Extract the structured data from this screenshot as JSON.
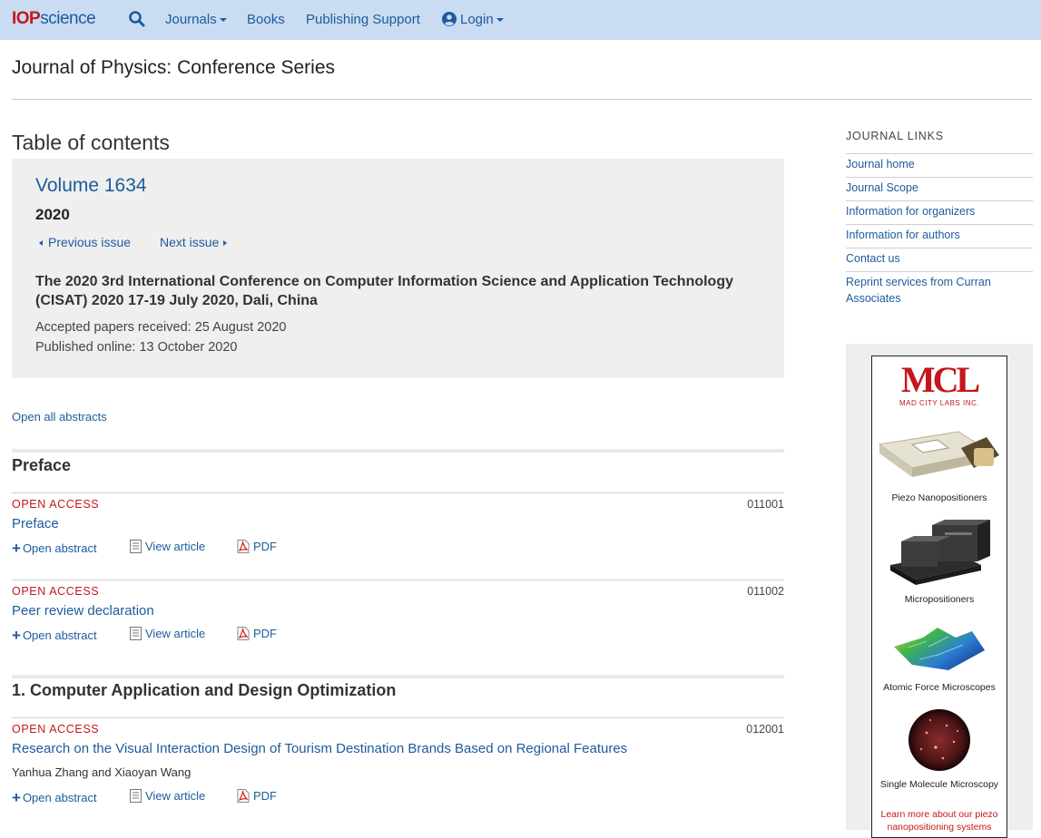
{
  "nav": {
    "logo_iop": "IOP",
    "logo_science": "science",
    "search_icon": "search-icon",
    "journals": "Journals",
    "books": "Books",
    "publishing_support": "Publishing Support",
    "login": "Login"
  },
  "journal_title": "Journal of Physics: Conference Series",
  "main": {
    "toc_heading": "Table of contents",
    "volume": {
      "title": "Volume 1634",
      "year": "2020",
      "prev": "Previous issue",
      "next": "Next issue",
      "conference": "The 2020 3rd International Conference on Computer Information Science and Application Technology (CISAT) 2020 17-19 July 2020, Dali, China",
      "accepted": "Accepted papers received: 25 August 2020",
      "published": "Published online: 13 October 2020"
    },
    "open_all": "Open all abstracts",
    "sections": [
      {
        "title": "Preface",
        "articles": [
          {
            "access": "OPEN ACCESS",
            "number": "011001",
            "title": "Preface",
            "authors": "",
            "open_abstract": "Open abstract",
            "view_article": "View article",
            "pdf": "PDF"
          },
          {
            "access": "OPEN ACCESS",
            "number": "011002",
            "title": "Peer review declaration",
            "authors": "",
            "open_abstract": "Open abstract",
            "view_article": "View article",
            "pdf": "PDF"
          }
        ]
      },
      {
        "title": "1. Computer Application and Design Optimization",
        "articles": [
          {
            "access": "OPEN ACCESS",
            "number": "012001",
            "title": "Research on the Visual Interaction Design of Tourism Destination Brands Based on Regional Features",
            "authors": "Yanhua Zhang and Xiaoyan Wang",
            "open_abstract": "Open abstract",
            "view_article": "View article",
            "pdf": "PDF"
          }
        ]
      }
    ]
  },
  "sidebar": {
    "heading": "JOURNAL LINKS",
    "links": [
      "Journal home",
      "Journal Scope",
      "Information for organizers",
      "Information for authors",
      "Contact us",
      "Reprint services from Curran Associates"
    ],
    "ad": {
      "logo": "MCL",
      "company": "MAD CITY LABS INC.",
      "captions": [
        "Piezo Nanopositioners",
        "Micropositioners",
        "Atomic Force Microscopes",
        "Single Molecule Microscopy"
      ],
      "learn_more": "Learn more about our piezo nanopositioning systems"
    }
  },
  "colors": {
    "nav_bg": "#c9dcf1",
    "link": "#1d5b9b",
    "accent_red": "#c4161c",
    "volume_box": "#efefef"
  }
}
